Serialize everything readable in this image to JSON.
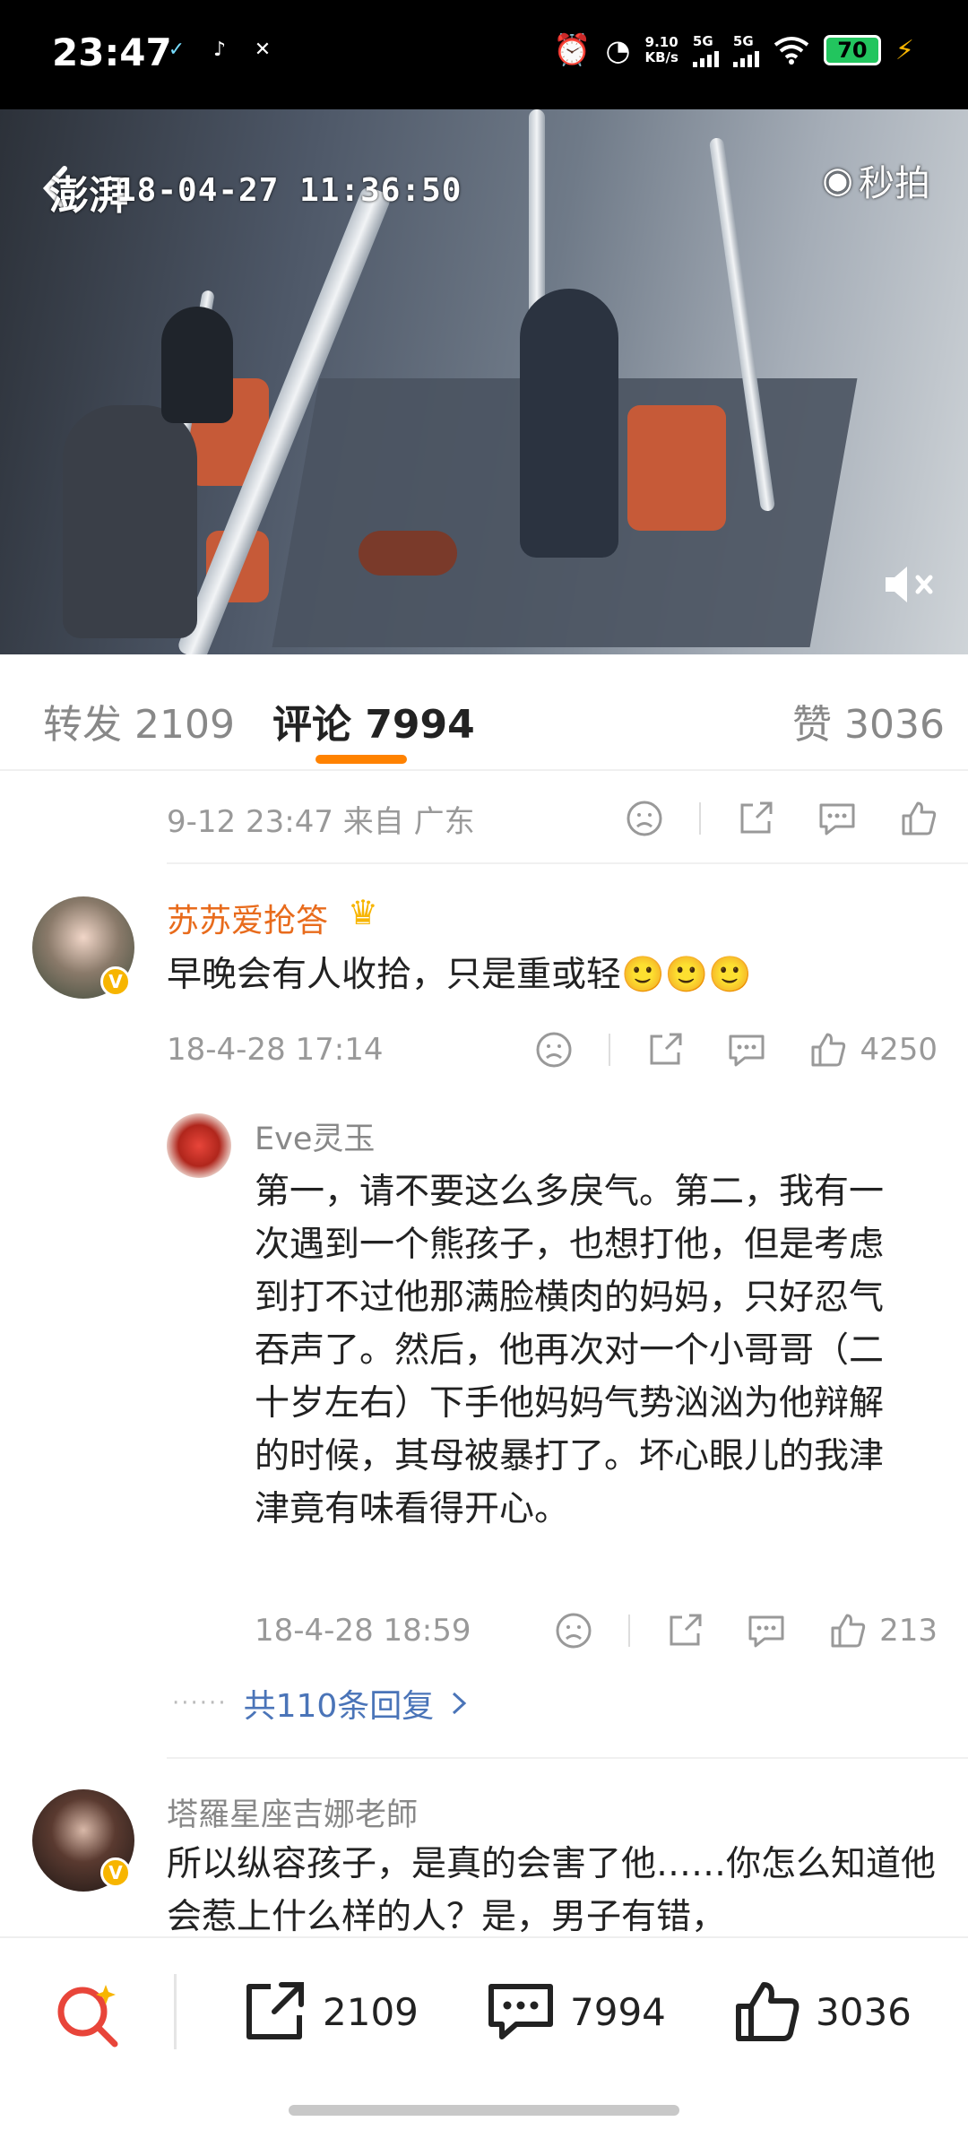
{
  "status_bar": {
    "time": "23:47",
    "net_speed_value": "9.10",
    "net_speed_unit": "KB/s",
    "sim1": "5G",
    "sim2": "5G",
    "battery": "70"
  },
  "video": {
    "timestamp": "18-04-27 11:36:50",
    "source_logo_left": "澎湃",
    "source_logo_right": "秒拍"
  },
  "tabs": {
    "repost": "转发 2109",
    "comments": "评论 7994",
    "likes": "赞 3036"
  },
  "post_meta": {
    "time_source": "9-12 23:47  来自 广东"
  },
  "comments": [
    {
      "username": "苏苏爱抢答",
      "text": "早晚会有人收拾，只是重或轻🙂🙂🙂",
      "time": "18-4-28 17:14",
      "likes": "4250",
      "reply": {
        "username": "Eve灵玉",
        "text": "第一，请不要这么多戾气。第二，我有一次遇到一个熊孩子，也想打他，但是考虑到打不过他那满脸横肉的妈妈，只好忍气吞声了。然后，他再次对一个小哥哥（二十岁左右）下手他妈妈气势汹汹为他辩解的时候，其母被暴打了。坏心眼儿的我津津竟有味看得开心。",
        "time": "18-4-28 18:59",
        "likes": "213"
      },
      "more_replies": "共110条回复",
      "more_dots": "······"
    },
    {
      "username": "塔羅星座吉娜老師",
      "text": "所以纵容孩子，是真的会害了他……你怎么知道他会惹上什么样的人？是，男子有错，"
    }
  ],
  "bottom_bar": {
    "repost_count": "2109",
    "comment_count": "7994",
    "like_count": "3036"
  },
  "colors": {
    "accent_orange": "#ff8200",
    "username_orange": "#e86b1c",
    "badge_gold": "#f7b500"
  }
}
